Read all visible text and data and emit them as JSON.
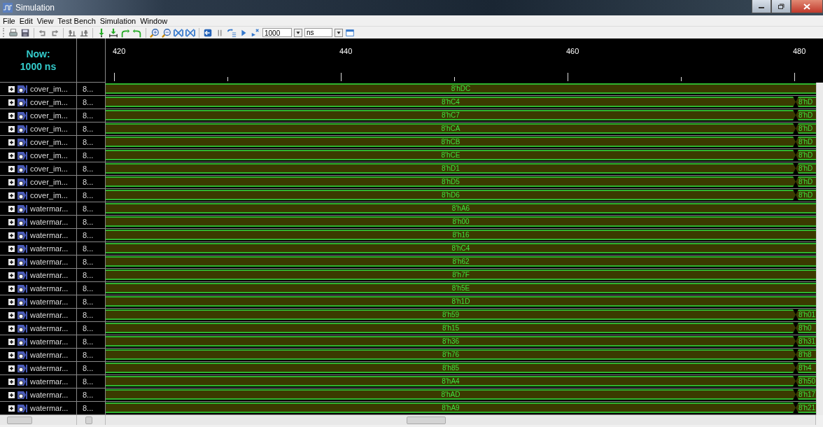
{
  "window": {
    "title": "Simulation"
  },
  "menu": [
    "File",
    "Edit",
    "View",
    "Test Bench",
    "Simulation",
    "Window"
  ],
  "toolbar": {
    "run_time": "1000",
    "unit": "ns"
  },
  "now": {
    "label": "Now:",
    "time": "1000 ns"
  },
  "timeline": {
    "labels": [
      "420",
      "440",
      "460",
      "480"
    ]
  },
  "signals": [
    {
      "name": "cover_im...",
      "value": "8...",
      "expanded": false,
      "segments": [
        "8'hDC"
      ]
    },
    {
      "name": "cover_im...",
      "value": "8...",
      "expanded": false,
      "segments": [
        "8'hC4",
        "8'hD"
      ]
    },
    {
      "name": "cover_im...",
      "value": "8...",
      "expanded": false,
      "segments": [
        "8'hC7",
        "8'hD"
      ]
    },
    {
      "name": "cover_im...",
      "value": "8...",
      "expanded": false,
      "segments": [
        "8'hCA",
        "8'hD"
      ]
    },
    {
      "name": "cover_im...",
      "value": "8...",
      "expanded": false,
      "segments": [
        "8'hCB",
        "8'hD"
      ]
    },
    {
      "name": "cover_im...",
      "value": "8...",
      "expanded": false,
      "segments": [
        "8'hCE",
        "8'hD"
      ]
    },
    {
      "name": "cover_im...",
      "value": "8...",
      "expanded": false,
      "segments": [
        "8'hD1",
        "8'hD"
      ]
    },
    {
      "name": "cover_im...",
      "value": "8...",
      "expanded": false,
      "segments": [
        "8'hD5",
        "8'hD"
      ]
    },
    {
      "name": "cover_im...",
      "value": "8...",
      "expanded": false,
      "segments": [
        "8'hD6",
        "8'hD"
      ]
    },
    {
      "name": "watermar...",
      "value": "8...",
      "expanded": false,
      "segments": [
        "8'hA6"
      ]
    },
    {
      "name": "watermar...",
      "value": "8...",
      "expanded": false,
      "segments": [
        "8'h00"
      ]
    },
    {
      "name": "watermar...",
      "value": "8...",
      "expanded": false,
      "segments": [
        "8'h16"
      ]
    },
    {
      "name": "watermar...",
      "value": "8...",
      "expanded": false,
      "segments": [
        "8'hC4"
      ]
    },
    {
      "name": "watermar...",
      "value": "8...",
      "expanded": false,
      "segments": [
        "8'h62"
      ]
    },
    {
      "name": "watermar...",
      "value": "8...",
      "expanded": false,
      "segments": [
        "8'h7F"
      ]
    },
    {
      "name": "watermar...",
      "value": "8...",
      "expanded": false,
      "segments": [
        "8'h5E"
      ]
    },
    {
      "name": "watermar...",
      "value": "8...",
      "expanded": false,
      "segments": [
        "8'h1D"
      ]
    },
    {
      "name": "watermar...",
      "value": "8...",
      "expanded": false,
      "segments": [
        "8'h59",
        "8'h01"
      ]
    },
    {
      "name": "watermar...",
      "value": "8...",
      "expanded": false,
      "segments": [
        "8'h15",
        "8'h0"
      ]
    },
    {
      "name": "watermar...",
      "value": "8...",
      "expanded": false,
      "segments": [
        "8'h36",
        "8'h31"
      ]
    },
    {
      "name": "watermar...",
      "value": "8...",
      "expanded": false,
      "segments": [
        "8'h76",
        "8'h8"
      ]
    },
    {
      "name": "watermar...",
      "value": "8...",
      "expanded": false,
      "segments": [
        "8'h85",
        "8'h4"
      ]
    },
    {
      "name": "watermar...",
      "value": "8...",
      "expanded": false,
      "segments": [
        "8'hA4",
        "8'h50"
      ]
    },
    {
      "name": "watermar...",
      "value": "8...",
      "expanded": false,
      "segments": [
        "8'hAD",
        "8'h17"
      ]
    },
    {
      "name": "watermar...",
      "value": "8...",
      "expanded": false,
      "segments": [
        "8'hA9",
        "8'h21"
      ]
    }
  ]
}
